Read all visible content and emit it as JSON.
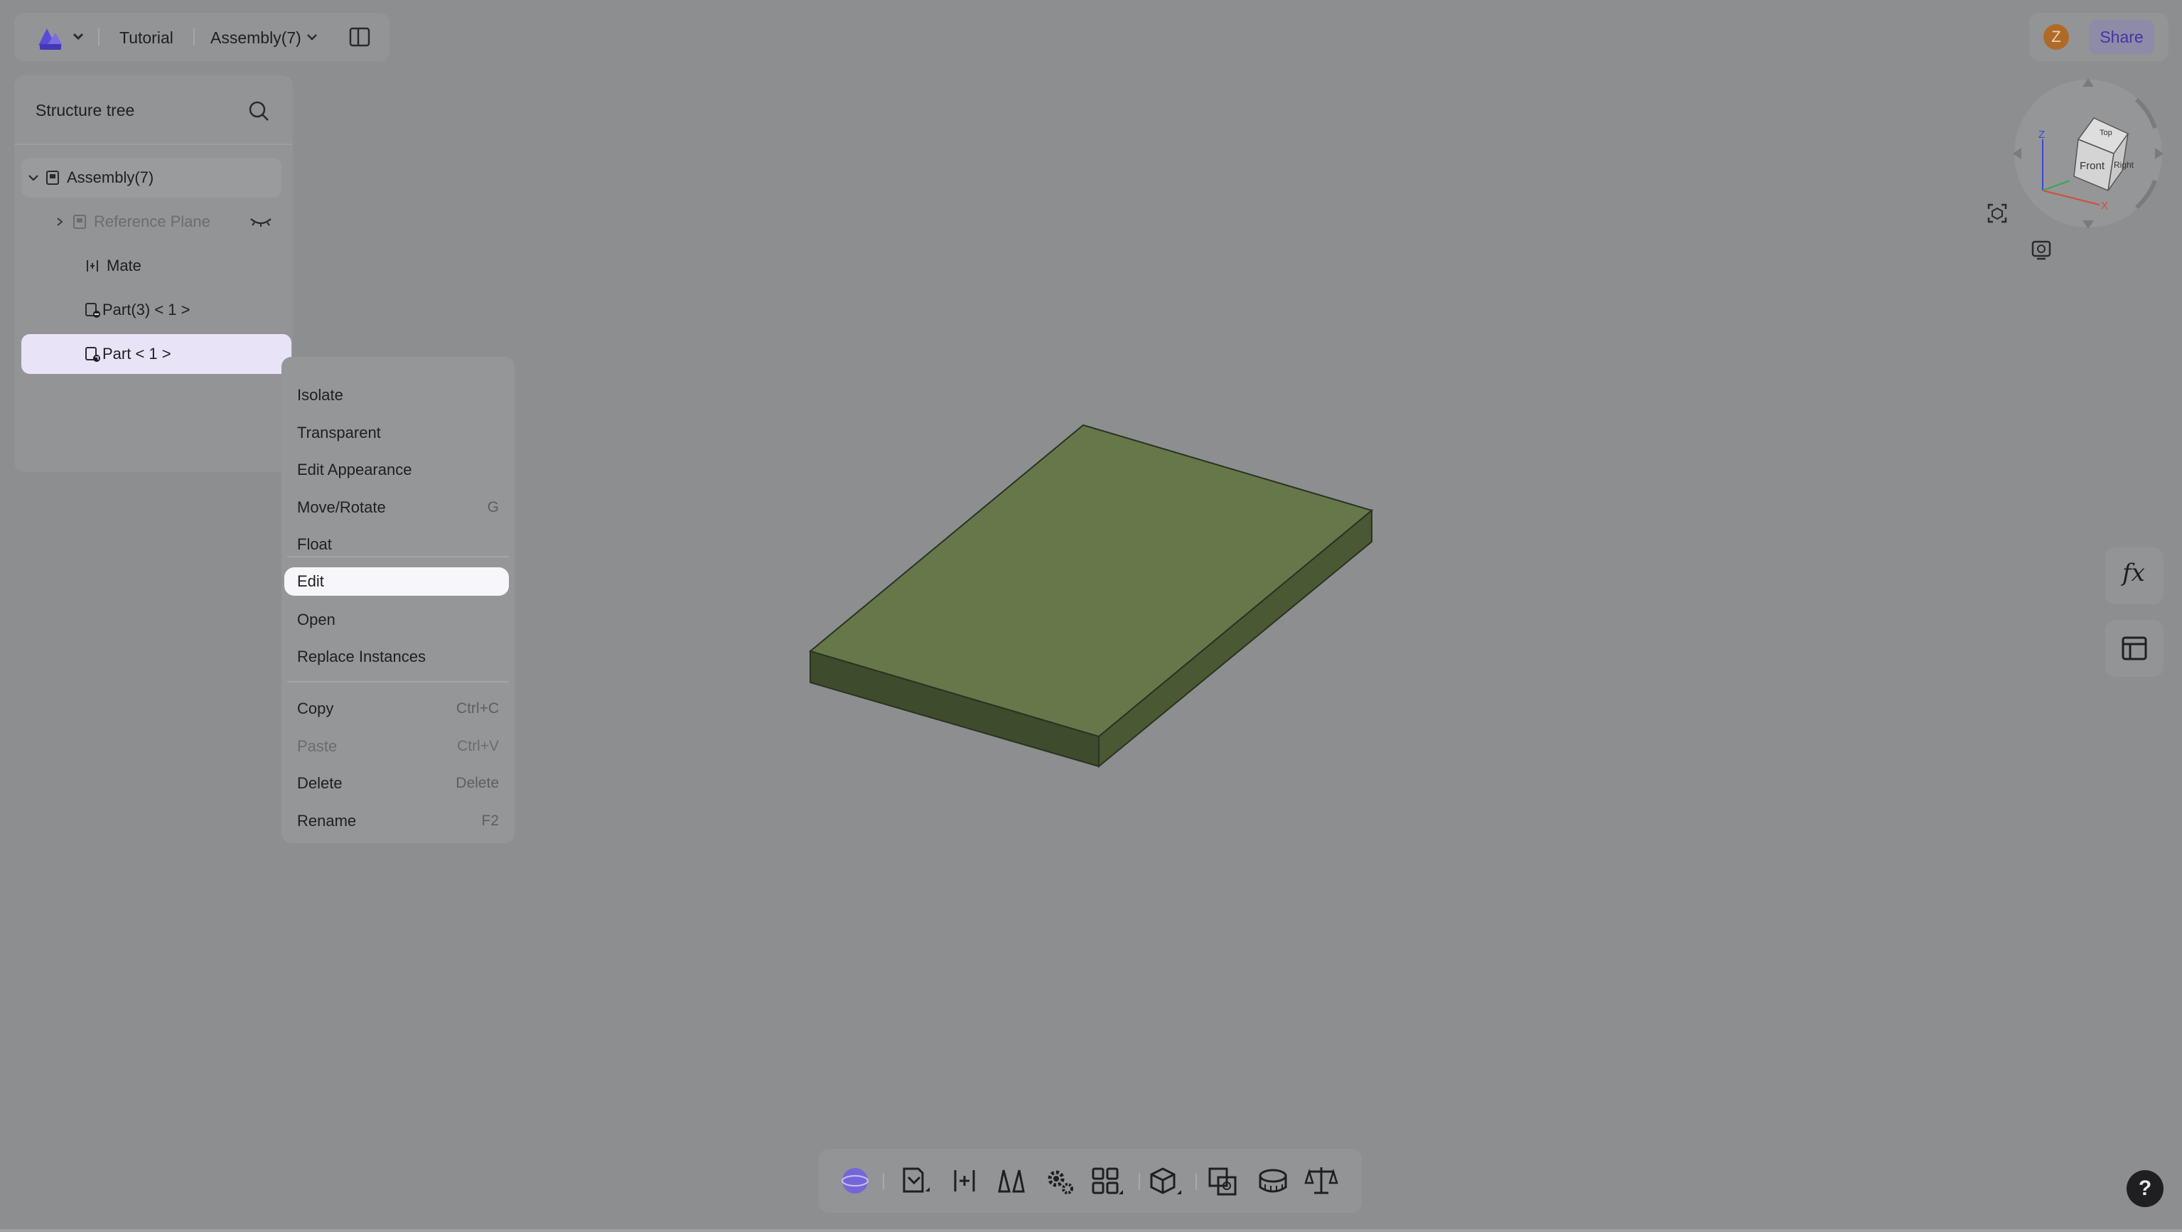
{
  "header": {
    "breadcrumb": [
      "Tutorial",
      "Assembly(7)"
    ],
    "share_label": "Share",
    "avatar_initial": "Z"
  },
  "tree": {
    "title": "Structure tree",
    "items": [
      {
        "label": "Assembly(7)"
      },
      {
        "label": "Reference Plane"
      },
      {
        "label": "Mate"
      },
      {
        "label": "Part(3) < 1 >"
      },
      {
        "label": "Part < 1 >"
      }
    ]
  },
  "context_menu": {
    "items": [
      {
        "label": "Isolate",
        "shortcut": ""
      },
      {
        "label": "Transparent",
        "shortcut": ""
      },
      {
        "label": "Edit Appearance",
        "shortcut": ""
      },
      {
        "label": "Move/Rotate",
        "shortcut": "G"
      },
      {
        "label": "Float",
        "shortcut": ""
      },
      {
        "label": "Edit",
        "shortcut": ""
      },
      {
        "label": "Open",
        "shortcut": ""
      },
      {
        "label": "Replace Instances",
        "shortcut": ""
      },
      {
        "label": "Copy",
        "shortcut": "Ctrl+C"
      },
      {
        "label": "Paste",
        "shortcut": "Ctrl+V"
      },
      {
        "label": "Delete",
        "shortcut": "Delete"
      },
      {
        "label": "Rename",
        "shortcut": "F2"
      }
    ]
  },
  "view_cube": {
    "faces": [
      "Top",
      "Front",
      "Right"
    ],
    "axes": [
      "Z",
      "X"
    ]
  },
  "side_buttons": {
    "formula_label": "fx"
  },
  "help_label": "?",
  "colors": {
    "accent": "#5b4bd6",
    "part_green": "#66784a",
    "selection": "#e9e3f8"
  }
}
